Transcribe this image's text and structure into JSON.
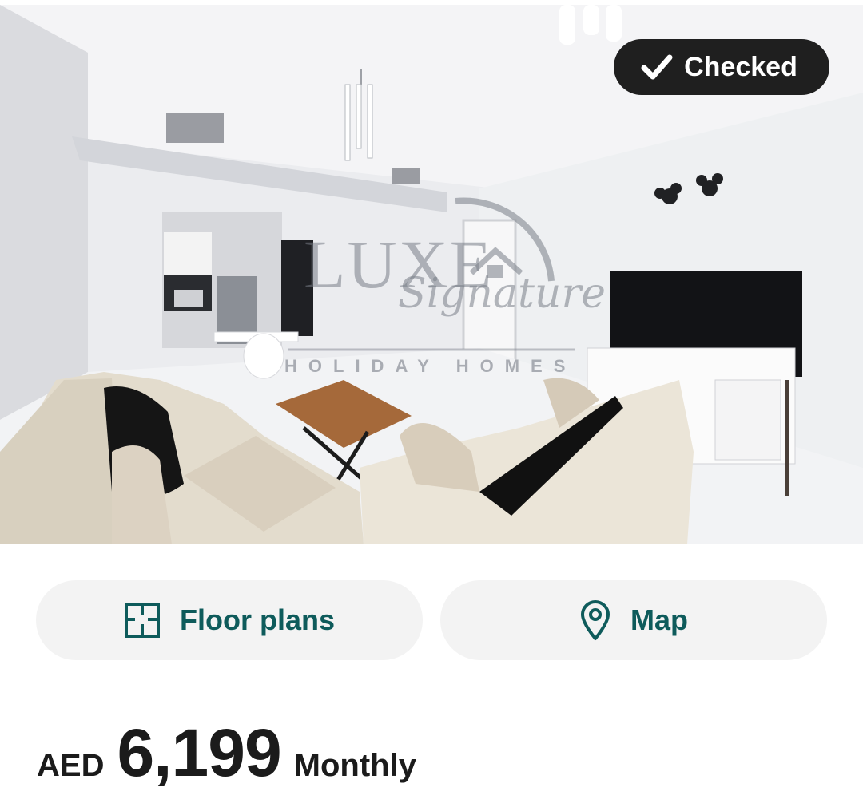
{
  "listing": {
    "badge_label": "Checked",
    "watermark": {
      "brand": "LUXE",
      "script": "Signature",
      "tagline": "HOLIDAY HOMES"
    },
    "photo_subject": "living-room-photo"
  },
  "actions": {
    "floor_plans_label": "Floor plans",
    "map_label": "Map"
  },
  "price": {
    "currency": "AED",
    "amount": "6,199",
    "period": "Monthly"
  },
  "colors": {
    "accent": "#0e5b5b",
    "badge_bg": "#1f1f1f",
    "button_bg": "#f3f3f3"
  }
}
